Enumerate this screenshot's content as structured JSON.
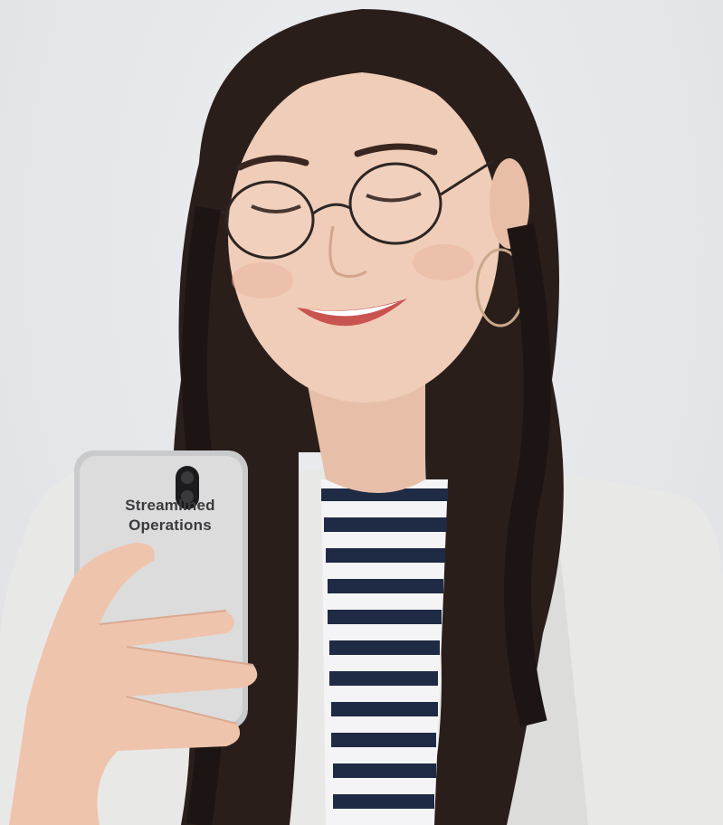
{
  "photo": {
    "subject": "woman-looking-at-phone",
    "background_color": "#e6e7ea",
    "jacket_color": "#e9e9e8",
    "hair_color": "#2a1e1b",
    "stripe_color": "#1f2a44"
  },
  "phone_overlay": {
    "line1": "Streamlined",
    "line2": "Operations"
  }
}
